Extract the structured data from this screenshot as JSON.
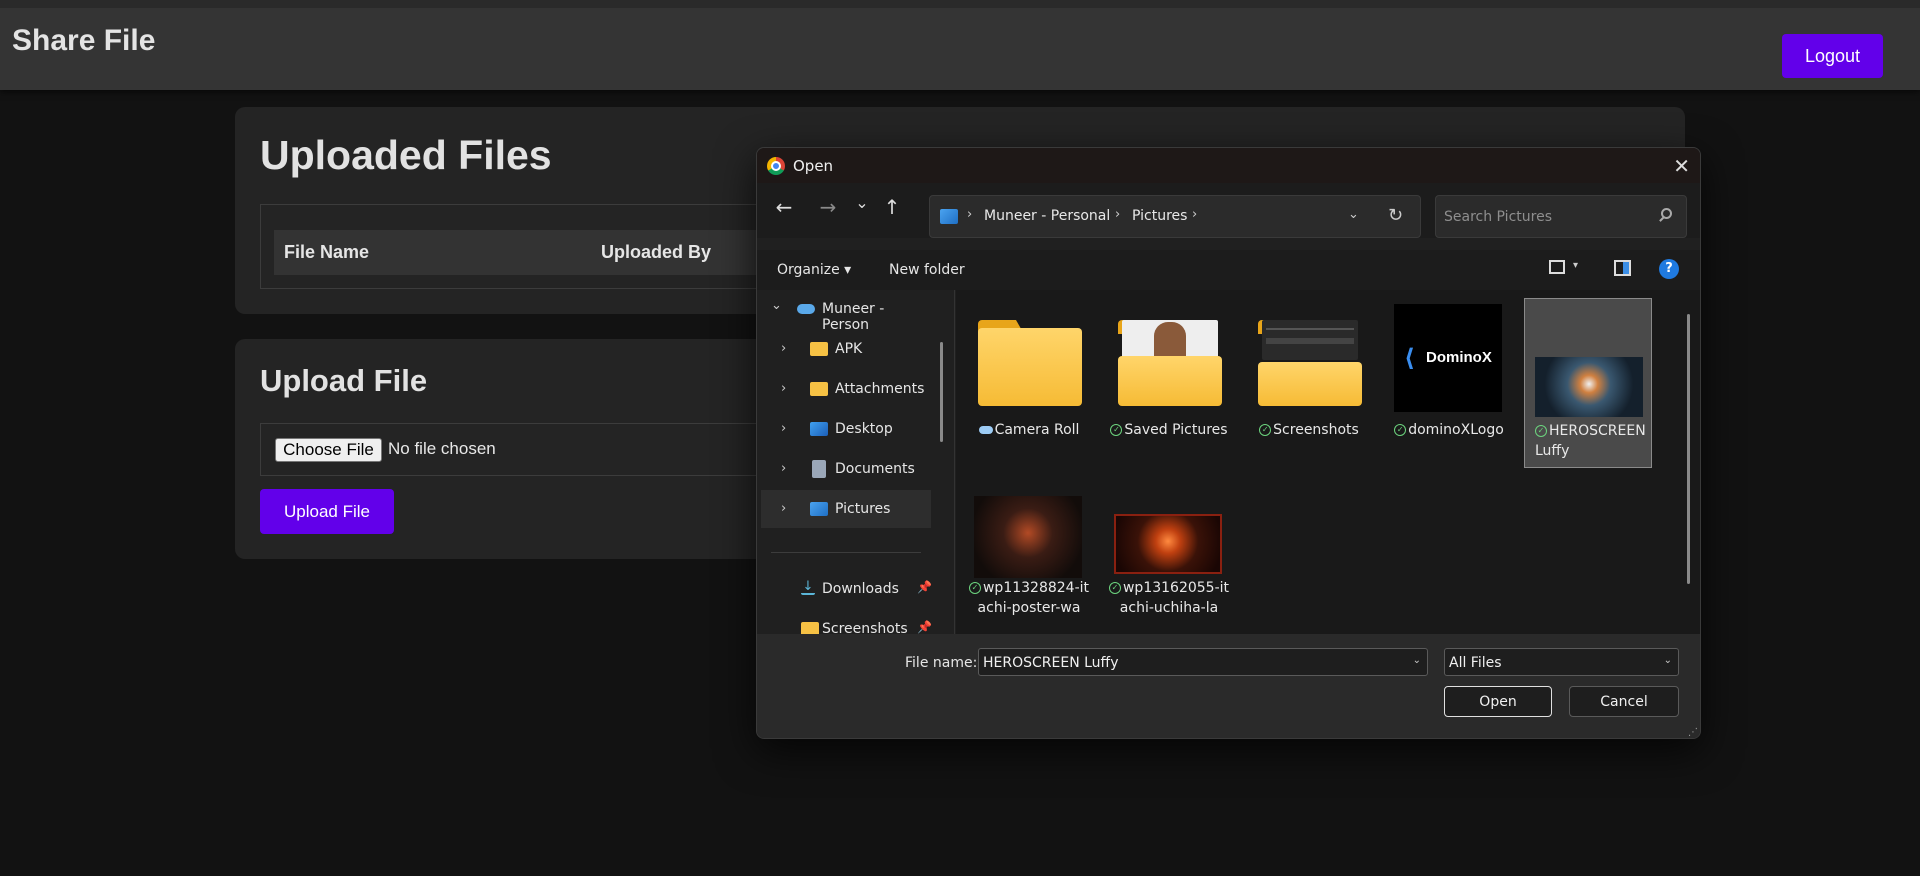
{
  "app": {
    "title": "Share File",
    "logout_label": "Logout"
  },
  "files_card": {
    "title": "Uploaded Files",
    "columns": [
      "File Name",
      "Uploaded By"
    ]
  },
  "upload_card": {
    "title": "Upload File",
    "choose_label": "Choose File",
    "no_file_text": "No file chosen",
    "upload_label": "Upload File"
  },
  "dialog": {
    "title": "Open",
    "close_glyph": "✕",
    "nav": {
      "back": "←",
      "forward": "→",
      "recent": "⌄",
      "up": "↑"
    },
    "address": {
      "crumbs": [
        "Muneer - Personal",
        "Pictures"
      ],
      "separator": "›",
      "dropdown": "⌄",
      "refresh": "↻"
    },
    "search_placeholder": "Search Pictures",
    "commands": {
      "organize": "Organize ▾",
      "new_folder": "New folder",
      "view_dd": "▾",
      "help": "?"
    },
    "nav_pane": {
      "root": {
        "label": "Muneer - Person",
        "chevron": "⌄"
      },
      "items": [
        {
          "label": "APK",
          "chevron": "›"
        },
        {
          "label": "Attachments",
          "chevron": "›"
        },
        {
          "label": "Desktop",
          "chevron": "›"
        },
        {
          "label": "Documents",
          "chevron": "›"
        },
        {
          "label": "Pictures",
          "chevron": "›"
        }
      ],
      "quick": [
        {
          "label": "Downloads",
          "pin": "📌"
        },
        {
          "label": "Screenshots",
          "pin": "📌"
        }
      ]
    },
    "items": [
      {
        "label": "Camera Roll",
        "kind": "folder"
      },
      {
        "label": "Saved Pictures",
        "kind": "folder"
      },
      {
        "label": "Screenshots",
        "kind": "folder"
      },
      {
        "label": "dominoXLogo",
        "kind": "image",
        "logo_text": "DominoX",
        "logo_glyph": "⟨"
      },
      {
        "label": "HEROSCREEN Luffy",
        "kind": "image"
      },
      {
        "label": "wp11328824-itachi-poster-wa",
        "kind": "image"
      },
      {
        "label": "wp13162055-itachi-uchiha-la",
        "kind": "image"
      }
    ],
    "footer": {
      "filename_label": "File name:",
      "filename_value": "HEROSCREEN Luffy",
      "filetype_value": "All Files",
      "dd_glyph": "⌄",
      "open_label": "Open",
      "cancel_label": "Cancel"
    }
  },
  "colors": {
    "accent": "#6200ea",
    "background": "#121212",
    "card": "#242424",
    "header": "#343434"
  }
}
